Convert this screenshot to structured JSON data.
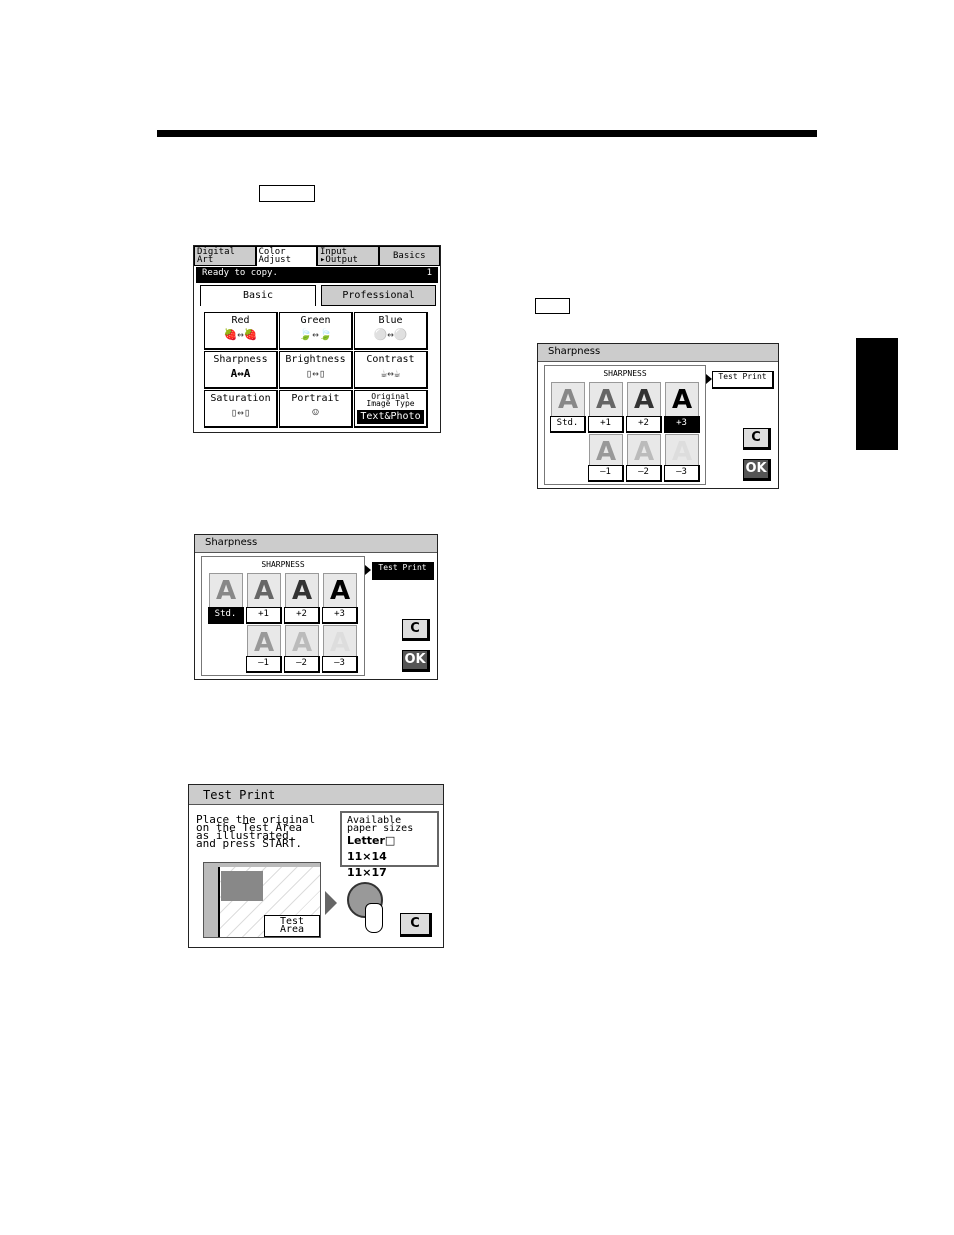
{
  "basic_screen": {
    "tabs": [
      "Digital Art",
      "Color Adjust",
      "Input ▸Output",
      "Basics"
    ],
    "status": "Ready to copy.",
    "count": "1",
    "subtabs": [
      "Basic",
      "Professional"
    ],
    "cells": [
      {
        "label": "Red",
        "icon": "🍓↔🍓"
      },
      {
        "label": "Green",
        "icon": "🍃↔🍃"
      },
      {
        "label": "Blue",
        "icon": "⚪↔⚪"
      },
      {
        "label": "Sharpness",
        "icon": "A↔A"
      },
      {
        "label": "Brightness",
        "icon": "▯↔▯"
      },
      {
        "label": "Contrast",
        "icon": "☕↔☕"
      },
      {
        "label": "Saturation",
        "icon": "▯↔▯"
      },
      {
        "label": "Portrait",
        "icon": "☺"
      },
      {
        "label": "Original Image Type",
        "value": "Text&Photo"
      }
    ]
  },
  "sharp_screen_1": {
    "title": "Sharpness",
    "heading": "SHARPNESS",
    "glyph": "A",
    "levels_top": [
      "Std.",
      "+1",
      "+2",
      "+3"
    ],
    "levels_bottom": [
      "–1",
      "–2",
      "–3"
    ],
    "selected": "Std.",
    "test_print": "Test Print",
    "clear": "C",
    "ok": "OK"
  },
  "sharp_screen_2": {
    "title": "Sharpness",
    "heading": "SHARPNESS",
    "glyph": "A",
    "levels_top": [
      "Std.",
      "+1",
      "+2",
      "+3"
    ],
    "levels_bottom": [
      "–1",
      "–2",
      "–3"
    ],
    "selected": "+3",
    "test_print": "Test Print",
    "clear": "C",
    "ok": "OK"
  },
  "test_print_screen": {
    "title": "Test Print",
    "instructions": [
      "Place the original",
      "on the Test Area",
      "as illustrated,",
      "and press START."
    ],
    "avail_title": [
      "Available",
      "paper sizes"
    ],
    "sizes": [
      "Letter□ 11×14",
      "11×17"
    ],
    "test_area": [
      "Test",
      "Area"
    ],
    "clear": "C"
  },
  "colors": {
    "screen_gray": "#cccccc",
    "selected": "#000000"
  }
}
